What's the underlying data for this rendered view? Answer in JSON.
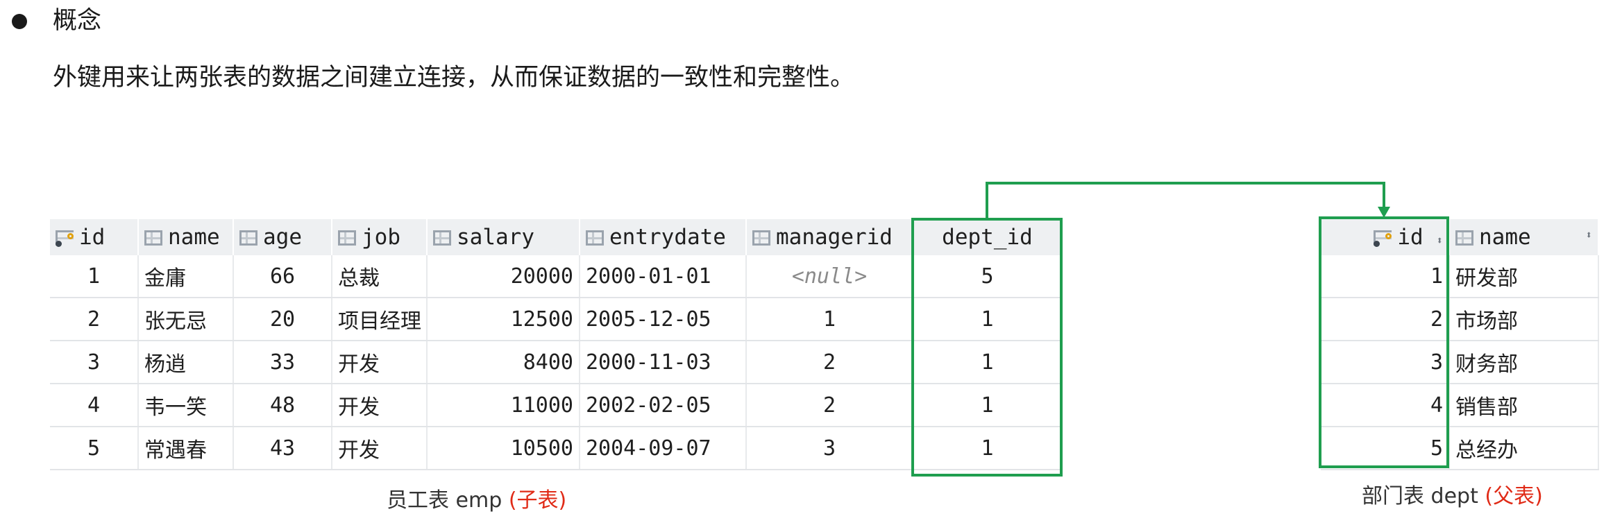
{
  "heading": "概念",
  "description": "外键用来让两张表的数据之间建立连接，从而保证数据的一致性和完整性。",
  "emp": {
    "columns": [
      "id",
      "name",
      "age",
      "job",
      "salary",
      "entrydate",
      "managerid",
      "dept_id"
    ],
    "rows": [
      [
        "1",
        "金庸",
        "66",
        "总裁",
        "20000",
        "2000-01-01",
        "<null>",
        "5"
      ],
      [
        "2",
        "张无忌",
        "20",
        "项目经理",
        "12500",
        "2005-12-05",
        "1",
        "1"
      ],
      [
        "3",
        "杨逍",
        "33",
        "开发",
        "8400",
        "2000-11-03",
        "2",
        "1"
      ],
      [
        "4",
        "韦一笑",
        "48",
        "开发",
        "11000",
        "2002-02-05",
        "2",
        "1"
      ],
      [
        "5",
        "常遇春",
        "43",
        "开发",
        "10500",
        "2004-09-07",
        "3",
        "1"
      ]
    ],
    "caption_main": "员工表 emp",
    "caption_tag": "(子表)"
  },
  "dept": {
    "columns": [
      "id",
      "name"
    ],
    "rows": [
      [
        "1",
        "研发部"
      ],
      [
        "2",
        "市场部"
      ],
      [
        "3",
        "财务部"
      ],
      [
        "4",
        "销售部"
      ],
      [
        "5",
        "总经办"
      ]
    ],
    "caption_main": "部门表 dept",
    "caption_tag": "(父表)"
  },
  "colors": {
    "highlight": "#1f9e4f",
    "tag": "#e02a16",
    "header_bg": "#eef0f2"
  }
}
